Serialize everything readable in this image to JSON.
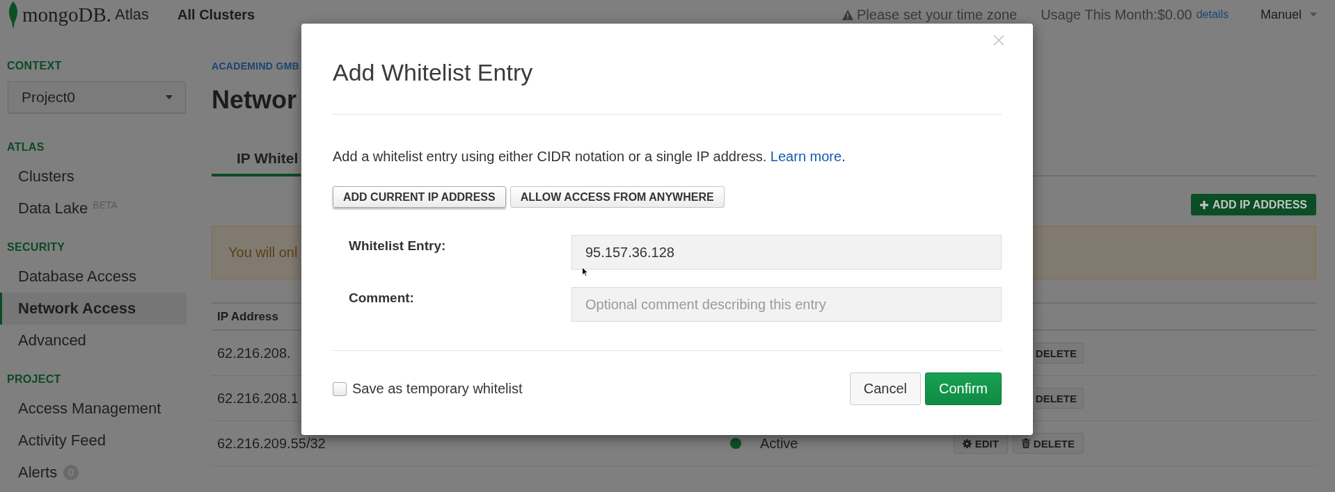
{
  "top_bar": {
    "logo": {
      "wordmark": "mongoDB.",
      "product": "Atlas"
    },
    "breadcrumb": "All Clusters",
    "notice": "Please set your time zone",
    "usage": "Usage This Month:$0.00",
    "usage_link": "details",
    "user": "Manuel"
  },
  "sidebar": {
    "context_label": "CONTEXT",
    "project": "Project0",
    "sections": [
      {
        "title": "ATLAS",
        "items": [
          {
            "label": "Clusters",
            "selected": false
          },
          {
            "label": "Data Lake",
            "selected": false,
            "badge": {
              "kind": "tag",
              "text": "BETA"
            }
          }
        ]
      },
      {
        "title": "SECURITY",
        "items": [
          {
            "label": "Database Access",
            "selected": false
          },
          {
            "label": "Network Access",
            "selected": true
          },
          {
            "label": "Advanced",
            "selected": false
          }
        ]
      },
      {
        "title": "PROJECT",
        "items": [
          {
            "label": "Access Management",
            "selected": false
          },
          {
            "label": "Activity Feed",
            "selected": false
          },
          {
            "label": "Alerts",
            "selected": false,
            "badge": {
              "kind": "count",
              "text": "0"
            }
          }
        ]
      }
    ]
  },
  "main": {
    "organization": "ACADEMIND GMB",
    "title": "Networ",
    "tabs": [
      {
        "label": "IP Whitel",
        "selected": true
      }
    ],
    "add_button": "ADD IP ADDRESS",
    "notice": "You will onl",
    "table": {
      "columns": [
        "IP Address"
      ],
      "rows": [
        {
          "ip": "62.216.208.",
          "actions": [
            {
              "kind": "delete",
              "label": "DELETE",
              "clipped": true
            }
          ]
        },
        {
          "ip": "62.216.208.1",
          "actions": [
            {
              "kind": "delete",
              "label": "DELETE",
              "clipped": true
            }
          ]
        },
        {
          "ip": "62.216.209.55/32",
          "status": {
            "label": "Active",
            "color": "#0b5229"
          },
          "actions": [
            {
              "kind": "edit",
              "label": "EDIT",
              "clipped": false
            },
            {
              "kind": "delete",
              "label": "DELETE",
              "clipped": false
            }
          ]
        }
      ]
    }
  },
  "dialog": {
    "title": "Add Whitelist Entry",
    "description": {
      "text": "Add a whitelist entry using either CIDR notation or a single IP address.",
      "link": "Learn more",
      "end": "."
    },
    "quick_buttons": [
      {
        "label": "ADD CURRENT IP ADDRESS",
        "focused": true
      },
      {
        "label": "ALLOW ACCESS FROM ANYWHERE",
        "focused": false
      }
    ],
    "fields": [
      {
        "label": "Whitelist Entry:",
        "value": "95.157.36.128"
      },
      {
        "label": "Comment:",
        "placeholder": "Optional comment describing this entry"
      }
    ],
    "temporary": {
      "label": "Save as temporary whitelist",
      "checked": false
    },
    "buttons": [
      {
        "kind": "secondary",
        "label": "Cancel"
      },
      {
        "kind": "primary",
        "label": "Confirm"
      }
    ]
  }
}
